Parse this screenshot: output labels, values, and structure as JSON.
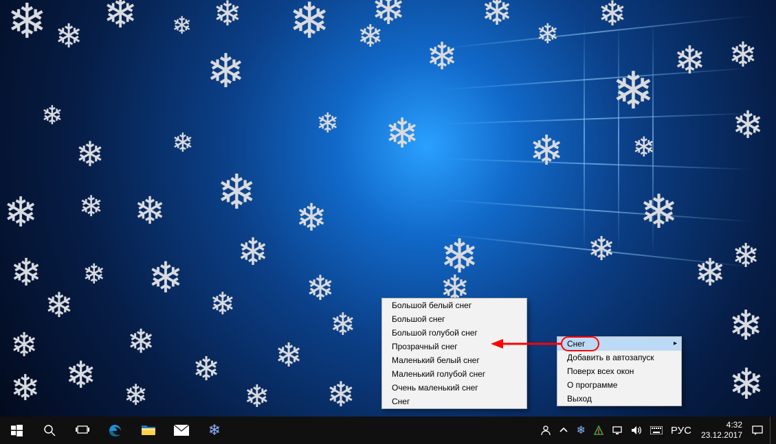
{
  "main_menu": {
    "items": [
      {
        "label": "Снег",
        "has_submenu": true,
        "highlighted": true
      },
      {
        "label": "Добавить в автозапуск"
      },
      {
        "label": "Поверх всех окон"
      },
      {
        "label": "О программе"
      },
      {
        "label": "Выход"
      }
    ]
  },
  "sub_menu": {
    "items": [
      {
        "label": "Большой белый снег"
      },
      {
        "label": "Большой снег"
      },
      {
        "label": "Большой голубой снег"
      },
      {
        "label": "Прозрачный снег"
      },
      {
        "label": "Маленький белый снег"
      },
      {
        "label": "Маленький голубой снег"
      },
      {
        "label": "Очень маленький снег"
      },
      {
        "label": "Снег"
      }
    ]
  },
  "taskbar": {
    "icons": {
      "start": "start",
      "search": "search",
      "taskview": "taskview",
      "edge": "edge",
      "explorer": "explorer",
      "mail": "mail",
      "snow_app": "snow-app"
    }
  },
  "tray": {
    "lang": "РУС",
    "time": "4:32",
    "date": "23.12.2017"
  },
  "annotations": {
    "ringed_label": "Снег"
  }
}
